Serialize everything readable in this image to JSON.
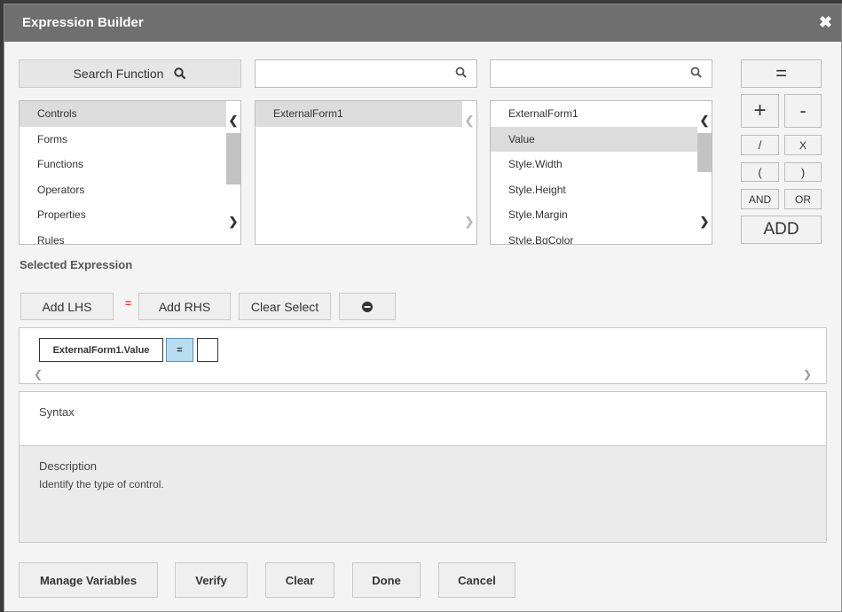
{
  "window": {
    "title": "Expression Builder",
    "close_label": "✖"
  },
  "search": {
    "function_label": "Search Function",
    "middle_placeholder": "",
    "right_placeholder": ""
  },
  "categories": {
    "items": [
      "Controls",
      "Forms",
      "Functions",
      "Operators",
      "Properties",
      "Rules"
    ],
    "selected": "Controls"
  },
  "controls_list": {
    "items": [
      "ExternalForm1"
    ],
    "selected": "ExternalForm1"
  },
  "properties_list": {
    "items": [
      "ExternalForm1",
      "Value",
      "Style.Width",
      "Style.Height",
      "Style.Margin",
      "Style.BgColor"
    ],
    "selected": "Value"
  },
  "operators": {
    "equals": "=",
    "plus": "+",
    "minus": "-",
    "divide": "/",
    "multiply": "X",
    "open_paren": "(",
    "close_paren": ")",
    "and": "AND",
    "or": "OR",
    "add": "ADD"
  },
  "selected_expression": {
    "label": "Selected Expression",
    "add_lhs": "Add LHS",
    "equals_marker": "=",
    "add_rhs": "Add RHS",
    "clear_select": "Clear Select",
    "tokens": [
      "ExternalForm1.Value",
      "=",
      ""
    ]
  },
  "syntax": {
    "label": "Syntax"
  },
  "description": {
    "label": "Description",
    "text": "Identify the type of control."
  },
  "footer": {
    "manage_variables": "Manage Variables",
    "verify": "Verify",
    "clear": "Clear",
    "done": "Done",
    "cancel": "Cancel"
  },
  "colors": {
    "titlebar": "#6f6f6f",
    "selected_row": "#dcdcdc",
    "equals_chip": "#b8dcf0",
    "equals_marker": "#e53935"
  }
}
